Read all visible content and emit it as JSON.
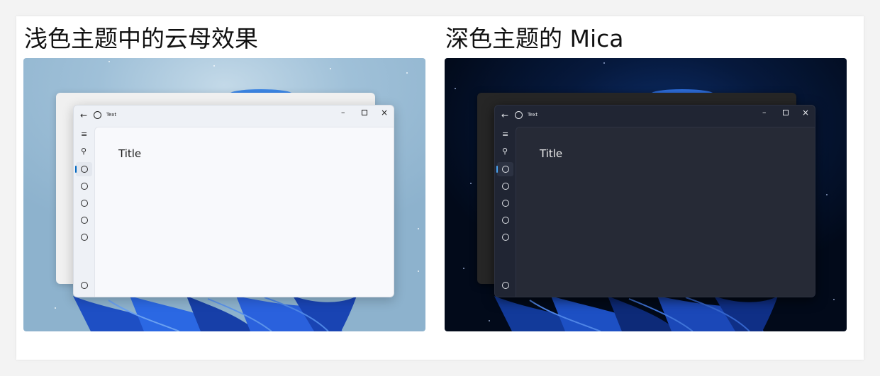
{
  "panels": {
    "light": {
      "heading": "浅色主题中的云母效果",
      "window": {
        "titlebar_text": "Text",
        "back_glyph": "←",
        "minimize_glyph": "–",
        "close_glyph": "×",
        "content_title": "Title",
        "menu_glyph": "≡",
        "search_glyph": "⚲"
      }
    },
    "dark": {
      "heading": "深色主题的 Mica",
      "window": {
        "titlebar_text": "Text",
        "back_glyph": "←",
        "minimize_glyph": "–",
        "close_glyph": "×",
        "content_title": "Title",
        "menu_glyph": "≡",
        "search_glyph": "⚲"
      }
    }
  },
  "icons": {
    "titlebar": [
      "back-arrow-icon",
      "app-circle-icon",
      "minimize-icon",
      "maximize-icon",
      "close-icon"
    ],
    "nav": [
      "hamburger-menu-icon",
      "search-icon",
      "circle-icon",
      "circle-icon",
      "circle-icon",
      "circle-icon",
      "circle-icon",
      "circle-icon"
    ]
  },
  "colors": {
    "accent": "#0067c0",
    "light_window": "#eef1f6",
    "dark_window": "#202533",
    "bloom": "#1f5ed8"
  }
}
